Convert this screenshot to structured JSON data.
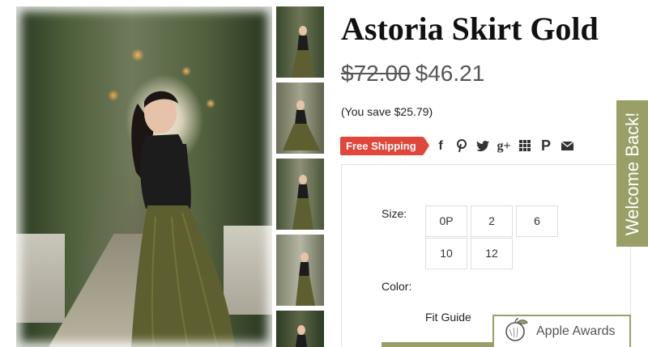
{
  "product": {
    "title": "Astoria Skirt Gold",
    "price_original": "$72.00",
    "price_sale": "$46.21",
    "savings": "(You save $25.79)"
  },
  "shipping_badge": "Free Shipping",
  "share_icons": [
    "facebook-icon",
    "pinterest-icon",
    "twitter-icon",
    "google-plus-icon",
    "grid-icon",
    "p-icon",
    "email-icon"
  ],
  "share_glyphs": {
    "facebook": "f",
    "pinterest": "𝓅",
    "google_plus": "g+",
    "p": "P"
  },
  "options": {
    "size_label": "Size:",
    "sizes": [
      "0P",
      "2",
      "6",
      "10",
      "12"
    ],
    "color_label": "Color:",
    "fit_guide": "Fit Guide"
  },
  "welcome_tab": "Welcome Back!",
  "awards": "Apple Awards",
  "colors": {
    "accent_olive": "#9a9f67",
    "shipping_red": "#e0473b"
  }
}
